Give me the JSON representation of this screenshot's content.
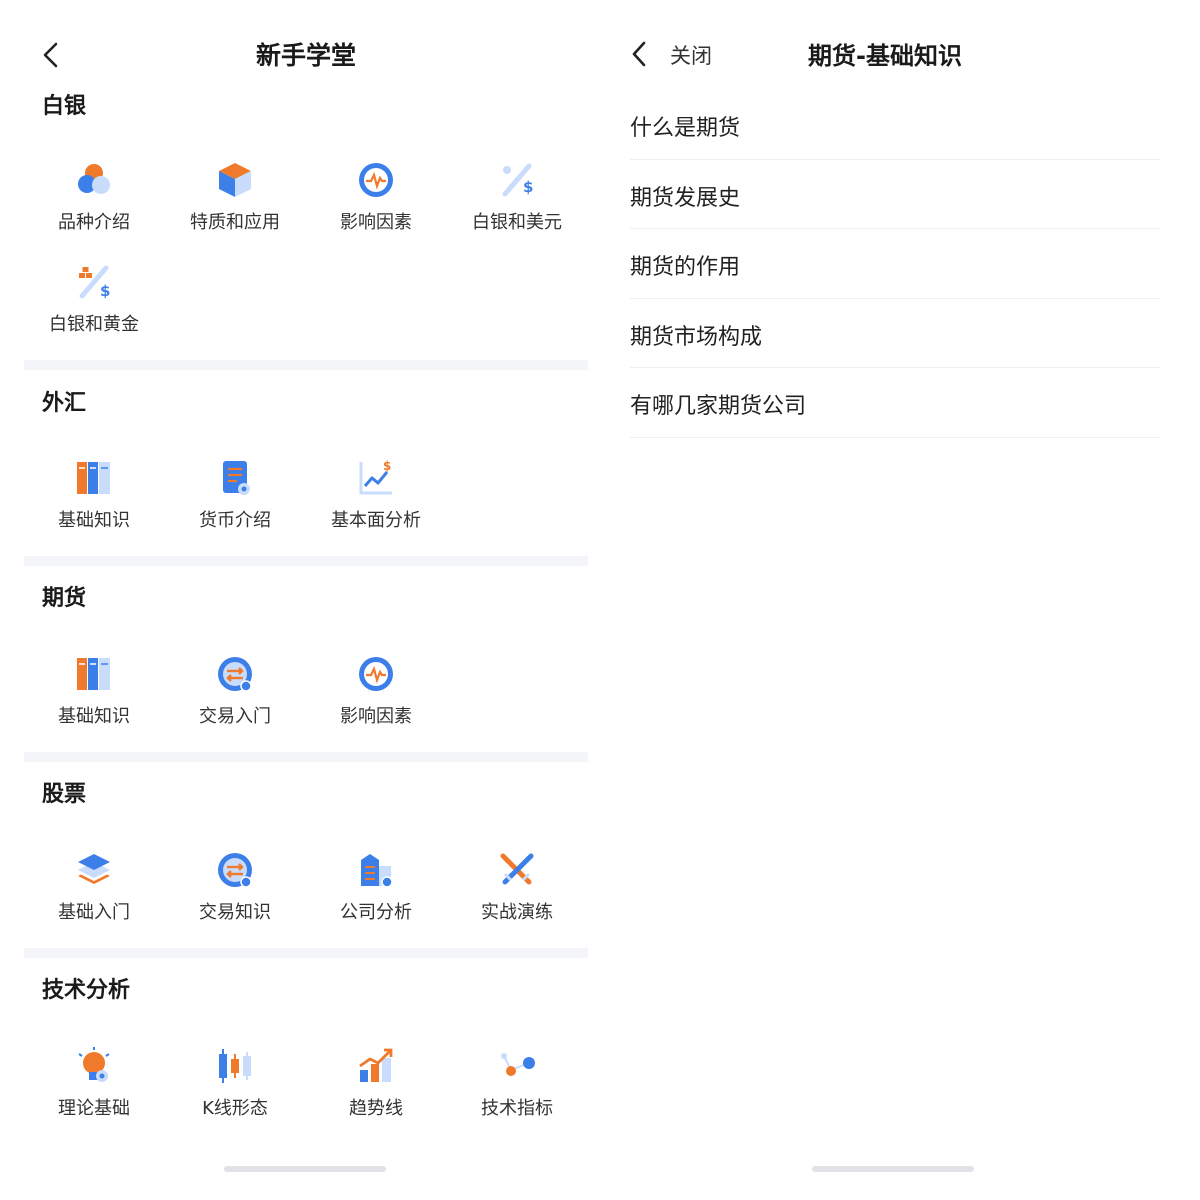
{
  "left": {
    "title": "新手学堂",
    "sections": [
      {
        "title": "白银",
        "items": [
          {
            "label": "品种介绍",
            "icon": "pie-icon"
          },
          {
            "label": "特质和应用",
            "icon": "cube-icon"
          },
          {
            "label": "影响因素",
            "icon": "pulse-icon"
          },
          {
            "label": "白银和美元",
            "icon": "percent-dollar-icon"
          },
          {
            "label": "白银和黄金",
            "icon": "gold-dollar-icon"
          }
        ]
      },
      {
        "title": "外汇",
        "items": [
          {
            "label": "基础知识",
            "icon": "books-icon"
          },
          {
            "label": "货币介绍",
            "icon": "document-icon"
          },
          {
            "label": "基本面分析",
            "icon": "line-chart-dollar-icon"
          }
        ]
      },
      {
        "title": "期货",
        "items": [
          {
            "label": "基础知识",
            "icon": "books-icon"
          },
          {
            "label": "交易入门",
            "icon": "exchange-icon"
          },
          {
            "label": "影响因素",
            "icon": "pulse-icon"
          }
        ]
      },
      {
        "title": "股票",
        "items": [
          {
            "label": "基础入门",
            "icon": "layers-icon"
          },
          {
            "label": "交易知识",
            "icon": "exchange-icon"
          },
          {
            "label": "公司分析",
            "icon": "building-icon"
          },
          {
            "label": "实战演练",
            "icon": "crossed-swords-icon"
          }
        ]
      },
      {
        "title": "技术分析",
        "items": [
          {
            "label": "理论基础",
            "icon": "lightbulb-icon"
          },
          {
            "label": "K线形态",
            "icon": "candlestick-icon"
          },
          {
            "label": "趋势线",
            "icon": "trend-bars-icon"
          },
          {
            "label": "技术指标",
            "icon": "dots-icon"
          }
        ]
      }
    ]
  },
  "right": {
    "close_label": "关闭",
    "title": "期货-基础知识",
    "items": [
      "什么是期货",
      "期货发展史",
      "期货的作用",
      "期货市场构成",
      "有哪几家期货公司"
    ]
  },
  "colors": {
    "blue": "#3d7fe8",
    "orange": "#f07a2c",
    "light_blue": "#c9dcfb"
  }
}
